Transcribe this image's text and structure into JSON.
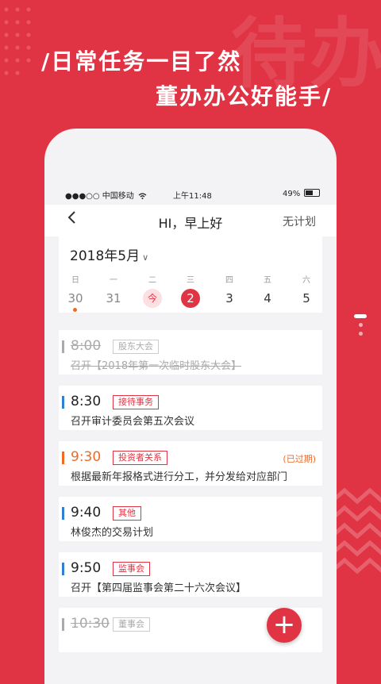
{
  "background": {
    "watermark": "待办",
    "accent": "#e03444"
  },
  "slogan": {
    "line1": "/日常任务一目了然",
    "line2": "董办办公好能手/"
  },
  "status_bar": {
    "carrier": "●●●○○ 中国移动",
    "time": "上午11:48",
    "battery": "49%"
  },
  "nav": {
    "title": "HI，早上好",
    "right_action": "无计划"
  },
  "calendar": {
    "month": "2018年5月",
    "weekdays": [
      "日",
      "一",
      "二",
      "三",
      "四",
      "五",
      "六"
    ],
    "days": [
      "30",
      "31",
      "今",
      "2",
      "3",
      "4",
      "5"
    ]
  },
  "events": [
    {
      "time": "8:00",
      "tag": "股东大会",
      "desc": "召开【2018年第一次临时股东大会】",
      "status": "done",
      "color": "#aaaaaa"
    },
    {
      "time": "8:30",
      "tag": "接待事务",
      "desc": "召开审计委员会第五次会议",
      "status": "normal",
      "color": "#2f7fd6"
    },
    {
      "time": "9:30",
      "tag": "投资者关系",
      "desc": "根据最新年报格式进行分工，并分发给对应部门",
      "status": "overdue",
      "note": "(已过期)",
      "color": "#f06a25"
    },
    {
      "time": "9:40",
      "tag": "其他",
      "desc": "林俊杰的交易计划",
      "status": "normal",
      "color": "#2f7fd6"
    },
    {
      "time": "9:50",
      "tag": "监事会",
      "desc": "召开【第四届监事会第二十六次会议】",
      "status": "normal",
      "color": "#2f7fd6"
    },
    {
      "time": "10:30",
      "tag": "董事会",
      "status": "done",
      "color": "#aaaaaa"
    }
  ],
  "fab_label": "+"
}
